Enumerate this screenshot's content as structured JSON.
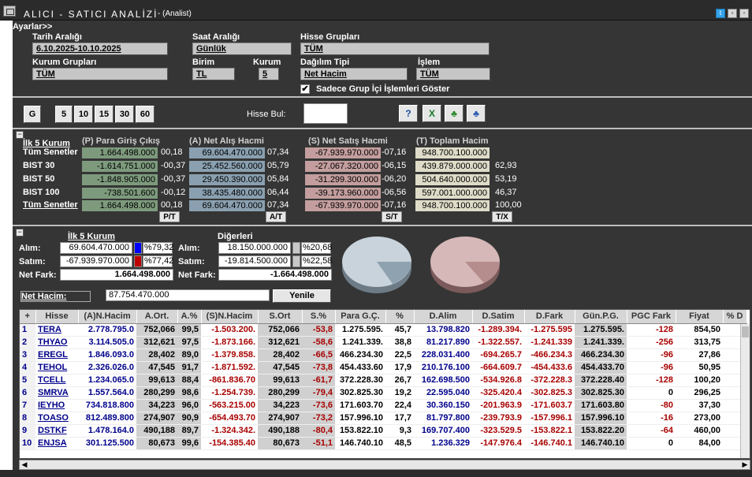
{
  "window": {
    "title": "ALICI - SATICI ANALİZİ",
    "subtitle": "- (Analist)"
  },
  "settings": {
    "ayarlar_label": "Ayarlar>>",
    "tarih_label": "Tarih Aralığı",
    "tarih_value": "6.10.2025-10.10.2025",
    "saat_label": "Saat Aralığı",
    "saat_value": "Günlük",
    "hisse_grup_label": "Hisse Grupları",
    "hisse_grup_value": "TÜM",
    "kurum_grup_label": "Kurum Grupları",
    "kurum_grup_value": "TÜM",
    "birim_label": "Birim",
    "birim_value": "TL",
    "kurum_label": "Kurum",
    "kurum_value": "5",
    "dagilim_label": "Dağılım Tipi",
    "dagilim_value": "Net Hacim",
    "islem_label": "İşlem",
    "islem_value": "TÜM",
    "sadece_label": "Sadece Grup İçi İşlemleri Göster",
    "sadece_checked": "✔"
  },
  "toolbar": {
    "g": "G",
    "b5": "5",
    "b10": "10",
    "b15": "15",
    "b30": "30",
    "b60": "60",
    "search_label": "Hisse Bul:",
    "search_value": ""
  },
  "summary": {
    "first5_label": "İlk 5 Kurum",
    "p_header": "(P) Para Giriş Çıkış",
    "a_header": "(A) Net Alış Hacmi",
    "s_header": "(S) Net Satış Hacmi",
    "t_header": "(T) Toplam Hacim",
    "rows": [
      {
        "label": "Tüm Senetler",
        "p": "1.664.498.000",
        "p_pct": "00,18",
        "a": "69.604.470.000",
        "a_pct": "07,34",
        "s": "-67.939.970.000",
        "s_pct": "-07,16",
        "t": "948.700.100.000",
        "t_pct": ""
      },
      {
        "label": "BIST 30",
        "p": "-1.614.751.000",
        "p_pct": "-00,37",
        "a": "25.452.560.000",
        "a_pct": "05,79",
        "s": "-27.067.320.000",
        "s_pct": "-06,15",
        "t": "439.879.000.000",
        "t_pct": "62,93"
      },
      {
        "label": "BIST 50",
        "p": "-1.848.905.000",
        "p_pct": "-00,37",
        "a": "29.450.390.000",
        "a_pct": "05,84",
        "s": "-31.299.300.000",
        "s_pct": "-06,20",
        "t": "504.640.000.000",
        "t_pct": "53,19"
      },
      {
        "label": "BIST 100",
        "p": "-738.501.600",
        "p_pct": "-00,12",
        "a": "38.435.480.000",
        "a_pct": "06,44",
        "s": "-39.173.960.000",
        "s_pct": "-06,56",
        "t": "597.001.000.000",
        "t_pct": "46,37"
      },
      {
        "label": "Tüm Senetler",
        "p": "1.664.498.000",
        "p_pct": "00,18",
        "a": "69.604.470.000",
        "a_pct": "07,34",
        "s": "-67.939.970.000",
        "s_pct": "-07,16",
        "t": "948.700.100.000",
        "t_pct": "100,00"
      }
    ],
    "pt_tag": "P/T",
    "at_tag": "A/T",
    "st_tag": "S/T",
    "tx_tag": "T/X"
  },
  "distribution": {
    "first5_label": "İlk 5 Kurum",
    "others_label": "Diğerleri",
    "alim_label": "Alım:",
    "satim_label": "Satım:",
    "netfark_label": "Net Fark:",
    "f_alim": "69.604.470.000",
    "f_alim_pct": "%79,32",
    "f_satim": "-67.939.970.000",
    "f_satim_pct": "%77,42",
    "f_net": "1.664.498.000",
    "o_alim": "18.150.000.000",
    "o_alim_pct": "%20,68",
    "o_satim": "-19.814.500.000",
    "o_satim_pct": "%22,58",
    "o_net": "-1.664.498.000",
    "alim_color": "#0000ff",
    "satim_color": "#c00000",
    "net_hacim_label": "Net Hacim:",
    "net_hacim_value": "87.754.470.000",
    "yenile_label": "Yenile"
  },
  "table": {
    "headers": [
      "+",
      "Hisse",
      "(A)N.Hacim",
      "A.Ort.",
      "A.%",
      "(S)N.Hacim",
      "S.Ort",
      "S.%",
      "Para G.Ç.",
      "%",
      "D.Alim",
      "D.Satim",
      "D.Fark",
      "Gün.P.G.",
      "PGC Fark",
      "Fiyat",
      "% D"
    ],
    "rows": [
      [
        "1",
        "TERA",
        "2.778.795.0",
        "752,066",
        "99,5",
        "-1.503.200.",
        "752,066",
        "-53,8",
        "1.275.595.",
        "45,7",
        "13.798.820",
        "-1.289.394.",
        "-1.275.595",
        "1.275.595.",
        "-128",
        "854,50",
        ""
      ],
      [
        "2",
        "THYAO",
        "3.114.505.0",
        "312,621",
        "97,5",
        "-1.873.166.",
        "312,621",
        "-58,6",
        "1.241.339.",
        "38,8",
        "81.217.890",
        "-1.322.557.",
        "-1.241.339",
        "1.241.339.",
        "-256",
        "313,75",
        ""
      ],
      [
        "3",
        "EREGL",
        "1.846.093.0",
        "28,402",
        "89,0",
        "-1.379.858.",
        "28,402",
        "-66,5",
        "466.234.30",
        "22,5",
        "228.031.400",
        "-694.265.7",
        "-466.234.3",
        "466.234.30",
        "-96",
        "27,86",
        ""
      ],
      [
        "4",
        "TEHOL",
        "2.326.026.0",
        "47,545",
        "91,7",
        "-1.871.592.",
        "47,545",
        "-73,8",
        "454.433.60",
        "17,9",
        "210.176.100",
        "-664.609.7",
        "-454.433.6",
        "454.433.70",
        "-96",
        "50,95",
        ""
      ],
      [
        "5",
        "TCELL",
        "1.234.065.0",
        "99,613",
        "88,4",
        "-861.836.70",
        "99,613",
        "-61,7",
        "372.228.30",
        "26,7",
        "162.698.500",
        "-534.926.8",
        "-372.228.3",
        "372.228.40",
        "-128",
        "100,20",
        ""
      ],
      [
        "6",
        "SMRVA",
        "1.557.564.0",
        "280,299",
        "98,6",
        "-1.254.739.",
        "280,299",
        "-79,4",
        "302.825.30",
        "19,2",
        "22.595.040",
        "-325.420.4",
        "-302.825.3",
        "302.825.30",
        "0",
        "296,25",
        ""
      ],
      [
        "7",
        "IEYHO",
        "734.818.800",
        "34,223",
        "96,0",
        "-563.215.00",
        "34,223",
        "-73,6",
        "171.603.70",
        "22,4",
        "30.360.150",
        "-201.963.9",
        "-171.603.7",
        "171.603.80",
        "-80",
        "37,30",
        ""
      ],
      [
        "8",
        "TOASO",
        "812.489.800",
        "274,907",
        "90,9",
        "-654.493.70",
        "274,907",
        "-73,2",
        "157.996.10",
        "17,7",
        "81.797.800",
        "-239.793.9",
        "-157.996.1",
        "157.996.10",
        "-16",
        "273,00",
        ""
      ],
      [
        "9",
        "DSTKF",
        "1.478.164.0",
        "490,188",
        "89,7",
        "-1.324.342.",
        "490,188",
        "-80,4",
        "153.822.10",
        "9,3",
        "169.707.400",
        "-323.529.5",
        "-153.822.1",
        "153.822.20",
        "-64",
        "460,00",
        ""
      ],
      [
        "10",
        "ENJSA",
        "301.125.500",
        "80,673",
        "99,6",
        "-154.385.40",
        "80,673",
        "-51,1",
        "146.740.10",
        "48,5",
        "1.236.329",
        "-147.976.4",
        "-146.740.1",
        "146.740.10",
        "0",
        "84,00",
        ""
      ]
    ]
  }
}
